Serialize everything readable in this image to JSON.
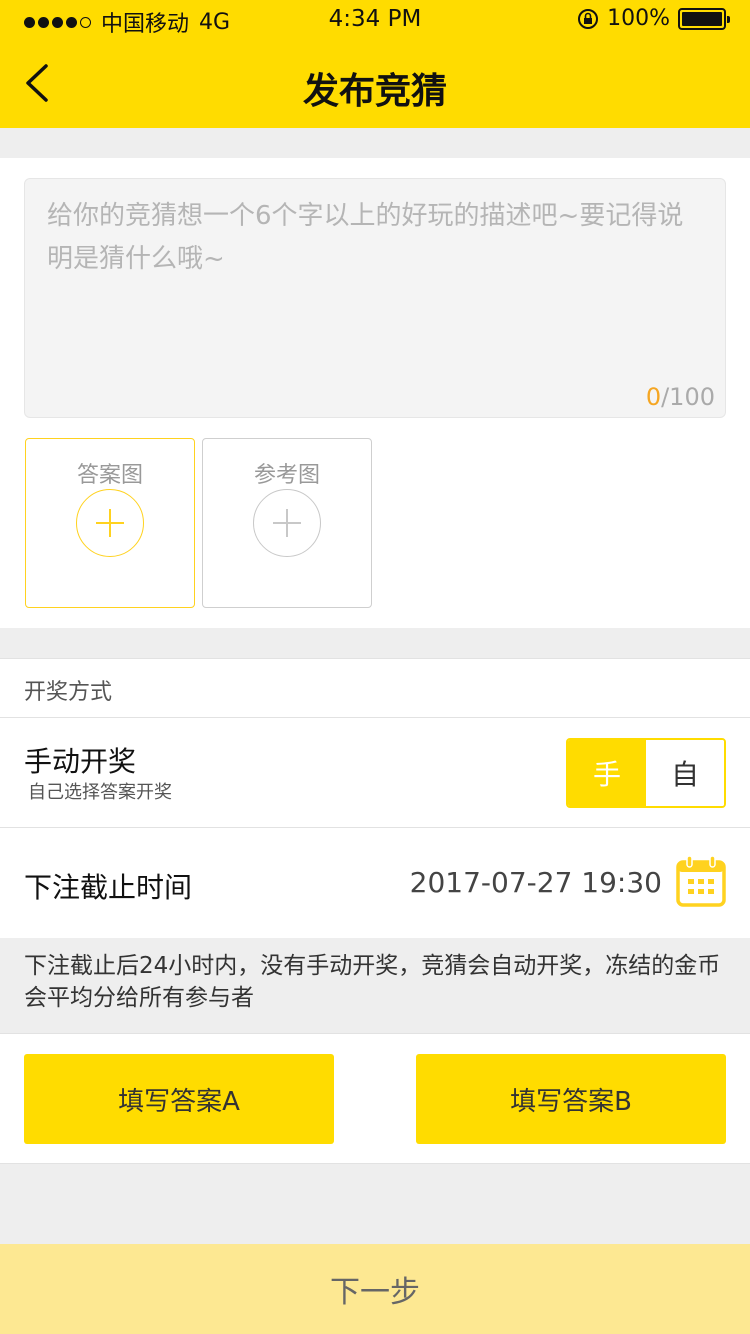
{
  "status_bar": {
    "carrier": "中国移动",
    "network": "4G",
    "time": "4:34 PM",
    "battery": "100%"
  },
  "nav": {
    "title": "发布竞猜",
    "back_icon": "chevron-left-icon"
  },
  "description": {
    "placeholder": "给你的竞猜想一个6个字以上的好玩的描述吧~要记得说明是猜什么哦~",
    "count": "0",
    "max": "/100"
  },
  "image_uploads": [
    {
      "label": "答案图",
      "icon": "plus-icon"
    },
    {
      "label": "参考图",
      "icon": "plus-icon"
    }
  ],
  "draw_method": {
    "section_title": "开奖方式",
    "mode_title": "手动开奖",
    "mode_subtitle": "自己选择答案开奖",
    "toggle_on": "手",
    "toggle_off": "自"
  },
  "deadline": {
    "label": "下注截止时间",
    "value": "2017-07-27 19:30",
    "icon": "calendar-icon"
  },
  "notice": "下注截止后24小时内，没有手动开奖，竞猜会自动开奖，冻结的金币会平均分给所有参与者",
  "answers": {
    "a_label": "填写答案A",
    "b_label": "填写答案B"
  },
  "next_label": "下一步",
  "colors": {
    "brand_yellow": "#ffdc00",
    "next_button_bg": "#fde892",
    "counter_accent": "#f5a623"
  }
}
